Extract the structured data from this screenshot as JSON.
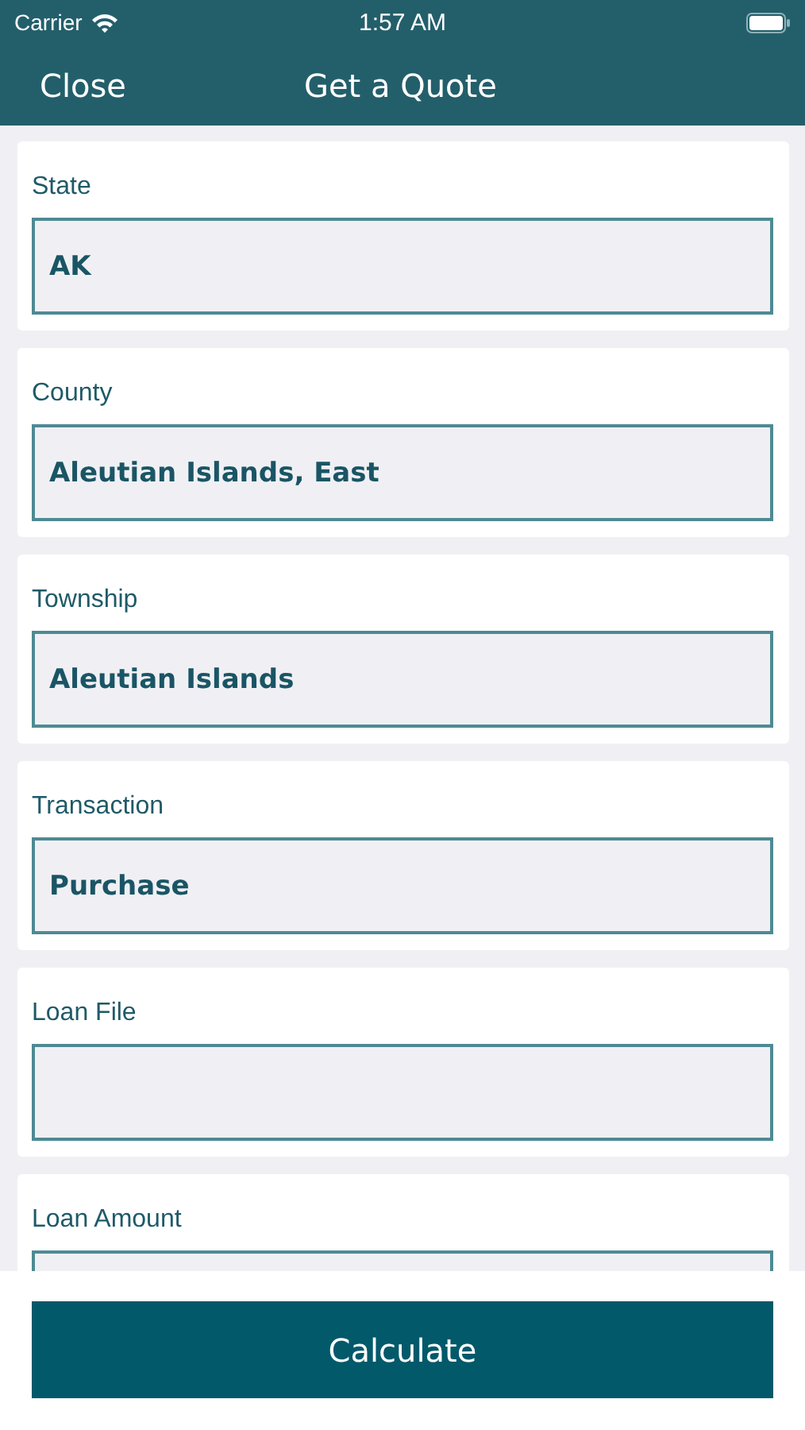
{
  "status_bar": {
    "carrier": "Carrier",
    "time": "1:57 AM"
  },
  "nav": {
    "close": "Close",
    "title": "Get a Quote"
  },
  "fields": [
    {
      "label": "State",
      "value": "AK"
    },
    {
      "label": "County",
      "value": "Aleutian Islands, East"
    },
    {
      "label": "Township",
      "value": "Aleutian Islands"
    },
    {
      "label": "Transaction",
      "value": "Purchase"
    },
    {
      "label": "Loan File"
    },
    {
      "label": "Loan Amount"
    }
  ],
  "button": "Calculate"
}
